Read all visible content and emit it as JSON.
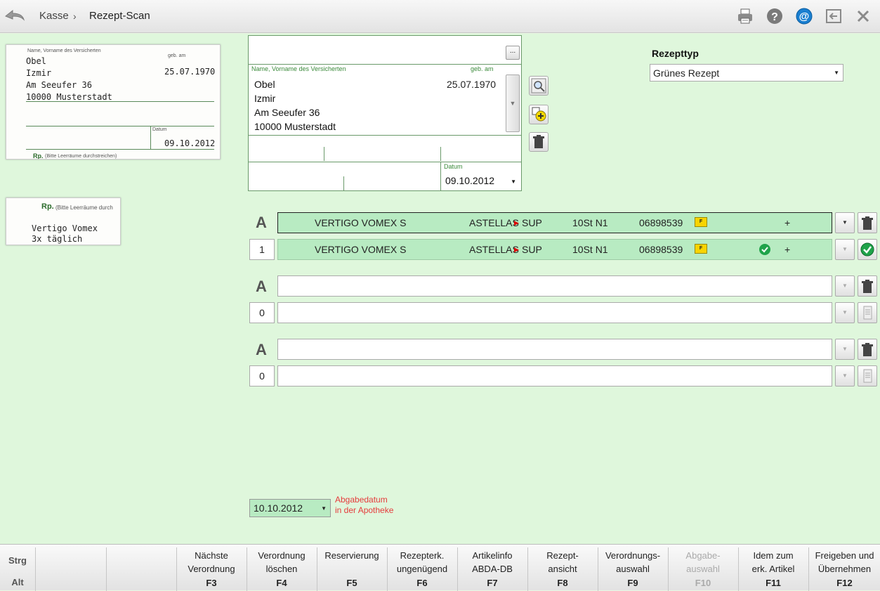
{
  "breadcrumb": {
    "root": "Kasse",
    "separator": "›",
    "current": "Rezept-Scan"
  },
  "toolbar_icons": [
    "printer-icon",
    "help-icon",
    "at-icon",
    "exit-icon",
    "close-icon"
  ],
  "scan": {
    "patient_header": "Name, Vorname des Versicherten",
    "dob_header": "geb. am",
    "lines": [
      "Obel",
      "Izmir",
      "Am Seeufer 36",
      "10000 Musterstadt"
    ],
    "dob": "25.07.1970",
    "date_label": "Datum",
    "date": "09.10.2012",
    "rp_label": "Rp.",
    "rp_hint": "(Bitte Leerräume durchstreichen)",
    "rp_hint_cut": "(Bitte Leerräume durch",
    "rx_lines": [
      "Vertigo Vomex",
      "3x täglich"
    ]
  },
  "form": {
    "dots_label": "...",
    "patient_header": "Name, Vorname des Versicherten",
    "dob_header": "geb. am",
    "lastname": "Obel",
    "firstname": "Izmir",
    "street": "Am Seeufer 36",
    "city": "10000 Musterstadt",
    "dob": "25.07.1970",
    "date_label": "Datum",
    "date": "09.10.2012"
  },
  "rezepttyp": {
    "label": "Rezepttyp",
    "value": "Grünes Rezept"
  },
  "rows": [
    {
      "letter": "A",
      "name": "VERTIGO VOMEX S",
      "maker": "ASTELLAS",
      "form": "SUP",
      "size": "10St N1",
      "pzn": "06898539",
      "badge": "F",
      "plus": "+"
    },
    {
      "qty": "1",
      "name": "VERTIGO VOMEX S",
      "maker": "ASTELLAS",
      "form": "SUP",
      "size": "10St N1",
      "pzn": "06898539",
      "badge": "F",
      "plus": "+"
    },
    {
      "letter": "A"
    },
    {
      "qty": "0"
    },
    {
      "letter": "A"
    },
    {
      "qty": "0"
    }
  ],
  "abgabe": {
    "date": "10.10.2012",
    "label_line1": "Abgabedatum",
    "label_line2": "in der Apotheke"
  },
  "modifiers": {
    "strg": "Strg",
    "alt": "Alt"
  },
  "fkeys": [
    {
      "label1": "Nächste",
      "label2": "Verordnung",
      "key": "F3",
      "enabled": true
    },
    {
      "label1": "Verordnung",
      "label2": "löschen",
      "key": "F4",
      "enabled": true
    },
    {
      "label1": "Reservierung",
      "label2": "",
      "key": "F5",
      "enabled": true
    },
    {
      "label1": "Rezepterk.",
      "label2": "ungenügend",
      "key": "F6",
      "enabled": true
    },
    {
      "label1": "Artikelinfo",
      "label2": "ABDA-DB",
      "key": "F7",
      "enabled": true
    },
    {
      "label1": "Rezept-",
      "label2": "ansicht",
      "key": "F8",
      "enabled": true
    },
    {
      "label1": "Verordnungs-",
      "label2": "auswahl",
      "key": "F9",
      "enabled": true
    },
    {
      "label1": "Abgabe-",
      "label2": "auswahl",
      "key": "F10",
      "enabled": false
    },
    {
      "label1": "Idem zum",
      "label2": "erk. Artikel",
      "key": "F11",
      "enabled": true
    },
    {
      "label1": "Freigeben und",
      "label2": "Übernehmen",
      "key": "F12",
      "enabled": true
    }
  ]
}
